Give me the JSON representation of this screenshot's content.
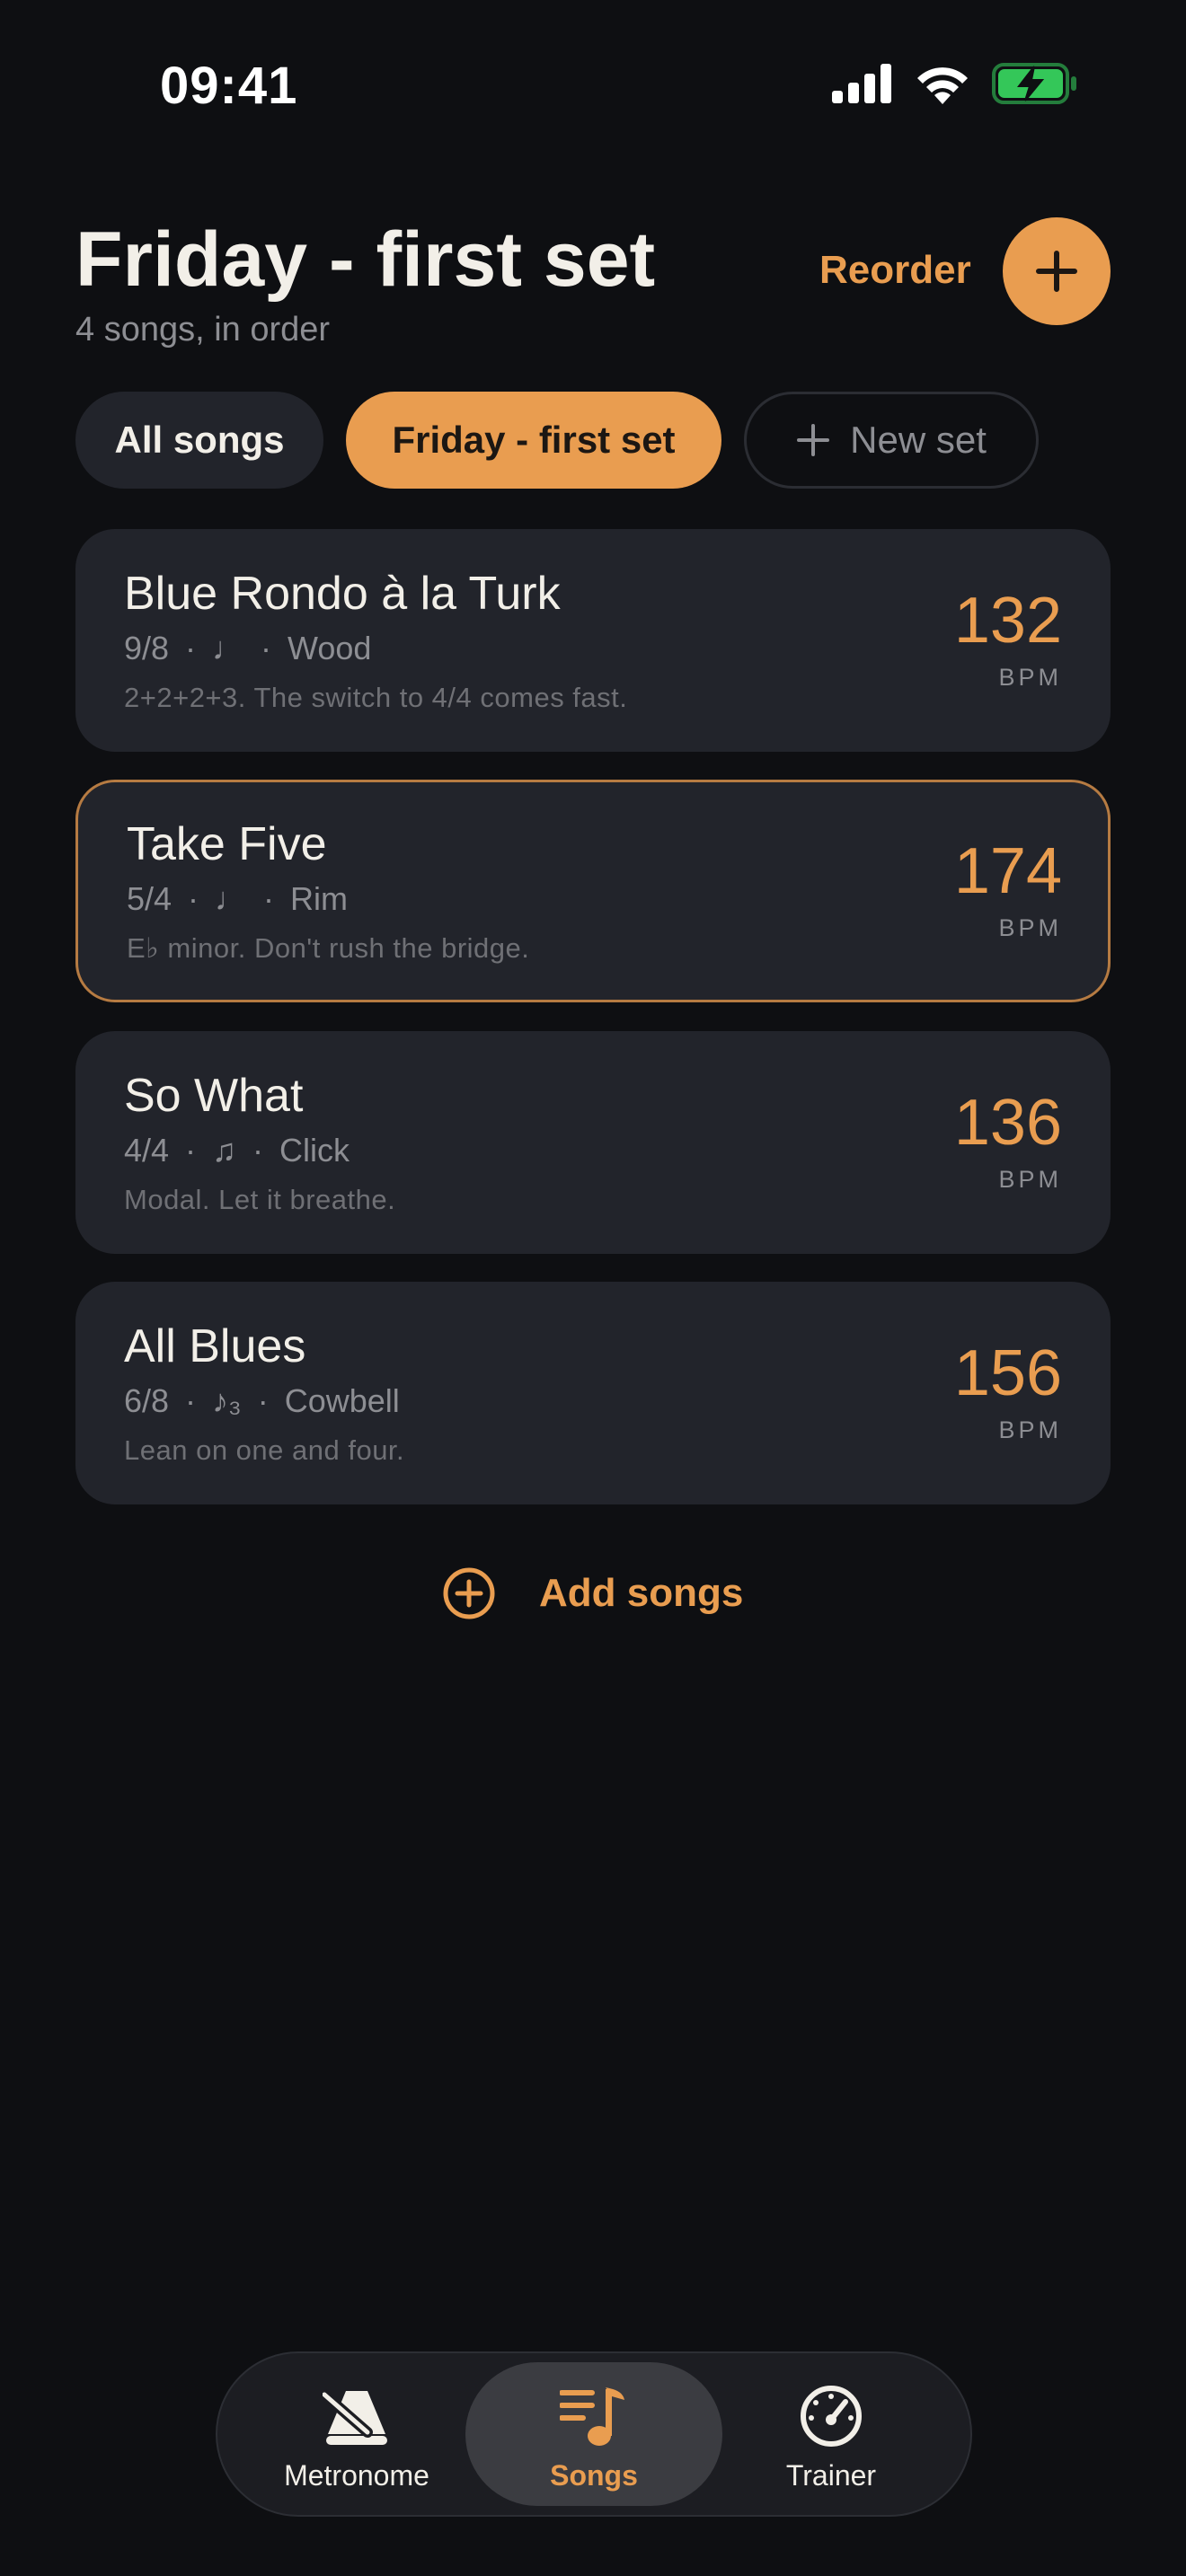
{
  "status_bar": {
    "time": "09:41"
  },
  "header": {
    "title": "Friday - first set",
    "subtitle": "4 songs, in order",
    "reorder_label": "Reorder"
  },
  "chips": [
    {
      "label": "All songs",
      "selected": false
    },
    {
      "label": "Friday - first set",
      "selected": true
    },
    {
      "label": "New set",
      "selected": false
    }
  ],
  "songs": [
    {
      "title": "Blue Rondo à la Turk",
      "meter": "9/8",
      "subdivision": "♩",
      "sound": "Wood",
      "note": "2+2+2+3. The switch to 4/4 comes fast.",
      "bpm": "132",
      "bpm_label": "BPM",
      "selected": false
    },
    {
      "title": "Take Five",
      "meter": "5/4",
      "subdivision": "♩",
      "sound": "Rim",
      "note": "E♭ minor. Don't rush the bridge.",
      "bpm": "174",
      "bpm_label": "BPM",
      "selected": true
    },
    {
      "title": "So What",
      "meter": "4/4",
      "subdivision": "♫",
      "sound": "Click",
      "note": "Modal. Let it breathe.",
      "bpm": "136",
      "bpm_label": "BPM",
      "selected": false
    },
    {
      "title": "All Blues",
      "meter": "6/8",
      "subdivision": "♪₃",
      "sound": "Cowbell",
      "note": "Lean on one and four.",
      "bpm": "156",
      "bpm_label": "BPM",
      "selected": false
    }
  ],
  "add_songs_label": "Add songs",
  "tabbar": {
    "tabs": [
      {
        "label": "Metronome",
        "icon": "metronome-icon",
        "active": false
      },
      {
        "label": "Songs",
        "icon": "songs-icon",
        "active": true
      },
      {
        "label": "Trainer",
        "icon": "gauge-icon",
        "active": false
      }
    ]
  },
  "colors": {
    "accent": "#e99d50",
    "background": "#0e0f12",
    "card": "#22242b",
    "battery": "#34c759"
  }
}
